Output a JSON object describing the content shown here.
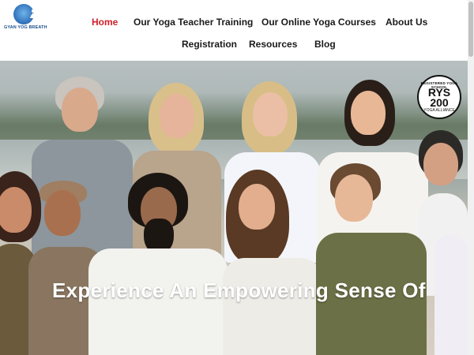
{
  "brand": {
    "name": "GYAN YOG BREATH"
  },
  "nav": {
    "items": [
      {
        "label": "Home",
        "active": true
      },
      {
        "label": "Our Yoga Teacher Training"
      },
      {
        "label": "Our Online Yoga Courses"
      },
      {
        "label": "About Us"
      },
      {
        "label": "Registration"
      },
      {
        "label": "Resources"
      },
      {
        "label": "Blog"
      }
    ]
  },
  "hero": {
    "badge": {
      "top": "REGISTERED YOGA SCHOOL",
      "main": "RYS 200",
      "sub": "YOGA ALLIANCE"
    },
    "heading": "Experience An Empowering Sense Of"
  },
  "colors": {
    "accent": "#d3202a",
    "nav_text": "#1a1a1a",
    "brand_blue": "#2f6fb8"
  }
}
